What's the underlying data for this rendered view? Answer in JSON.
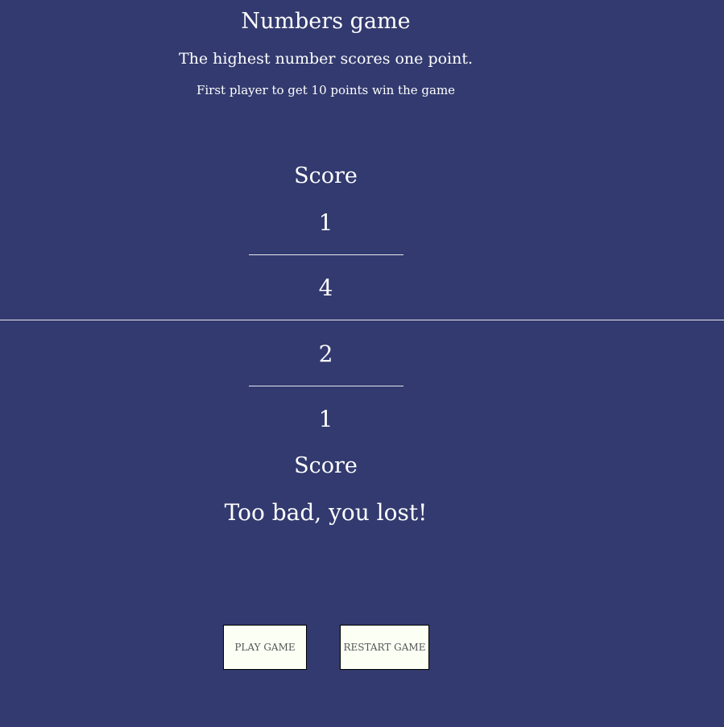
{
  "header": {
    "title": "Numbers game",
    "subtitle": "The highest number scores one point.",
    "rule": "First player to get 10 points win the game"
  },
  "board": {
    "top": {
      "score_label": "Score",
      "score": "1",
      "drawn_number": "4"
    },
    "bottom": {
      "drawn_number": "2",
      "score": "1",
      "score_label": "Score"
    },
    "result": "Too bad, you lost!"
  },
  "controls": {
    "play_label": "PLAY GAME",
    "restart_label": "RESTART GAME"
  }
}
